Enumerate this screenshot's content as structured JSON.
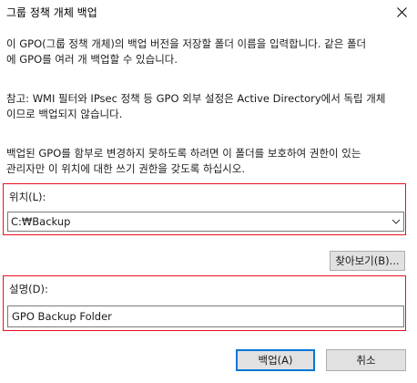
{
  "window": {
    "title": "그룹 정책 개체 백업"
  },
  "content": {
    "intro": "이 GPO(그룹 정책 개체)의 백업 버전을 저장할 폴더 이름을 입력합니다. 같은 폴더\n에 GPO를 여러 개 백업할 수 있습니다.",
    "note": "참고: WMI 필터와 IPsec 정책 등 GPO 외부 설정은 Active Directory에서 독립 개체\n이므로 백업되지 않습니다.",
    "warning": "백업된 GPO를 함부로 변경하지 못하도록 하려면 이 폴더를 보호하여 권한이 있는\n관리자만 이 위치에 대한 쓰기 권한을 갖도록 하십시오."
  },
  "location": {
    "label": "위치(L):",
    "value": "C:₩Backup"
  },
  "browse": {
    "label": "찾아보기(B)..."
  },
  "description": {
    "label": "설명(D):",
    "value": "GPO Backup Folder"
  },
  "buttons": {
    "backup": "백업(A)",
    "cancel": "취소"
  },
  "colors": {
    "highlight": "#e81123",
    "default_button_border": "#0078d7"
  }
}
